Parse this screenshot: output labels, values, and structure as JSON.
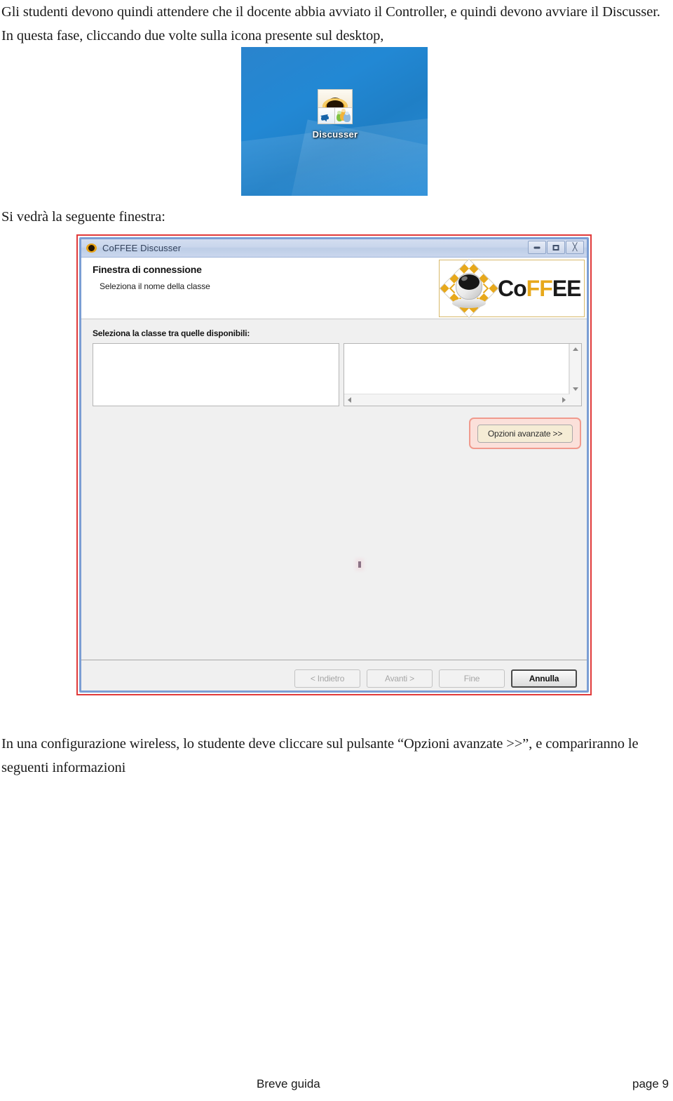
{
  "document": {
    "paragraph_intro": "Gli studenti devono quindi attendere che il docente abbia avviato il Controller, e quindi devono avviare il Discusser. In questa fase, cliccando due volte  sulla icona presente sul desktop,",
    "paragraph_window_intro": "Si vedrà la seguente finestra:",
    "paragraph_wireless": "In una configurazione wireless,  lo studente deve cliccare sul pulsante “Opzioni avanzate >>”, e compariranno le seguenti informazioni"
  },
  "desktop_screenshot": {
    "icon_label": "Discusser",
    "icon_name": "discusser-shortcut-icon",
    "background_color": "#2288d4"
  },
  "app_window": {
    "titlebar": {
      "icon": "coffee-cup-icon",
      "title": "CoFFEE Discusser",
      "controls": [
        {
          "name": "minimize",
          "glyph": ""
        },
        {
          "name": "maximize",
          "glyph": ""
        },
        {
          "name": "close",
          "glyph": "╳"
        }
      ]
    },
    "header": {
      "title": "Finestra di connessione",
      "subtitle": "Seleziona il nome della classe",
      "logo": {
        "part1": "Co",
        "part2": "FF",
        "part3": "EE",
        "accent_color": "#e7a81b"
      }
    },
    "body": {
      "select_label": "Seleziona la classe tra quelle disponibili:",
      "left_list_items": [],
      "right_list_items": [],
      "advanced_button_label": "Opzioni avanzate >>",
      "highlight_color": "#f09a8d"
    },
    "footer_buttons": [
      {
        "label": "< Indietro",
        "enabled": false
      },
      {
        "label": "Avanti >",
        "enabled": false
      },
      {
        "label": "Fine",
        "enabled": false
      },
      {
        "label": "Annulla",
        "enabled": true
      }
    ],
    "highlight_border_color": "#e03a3a"
  },
  "page_footer": {
    "left": "Breve guida",
    "right": "page 9"
  }
}
